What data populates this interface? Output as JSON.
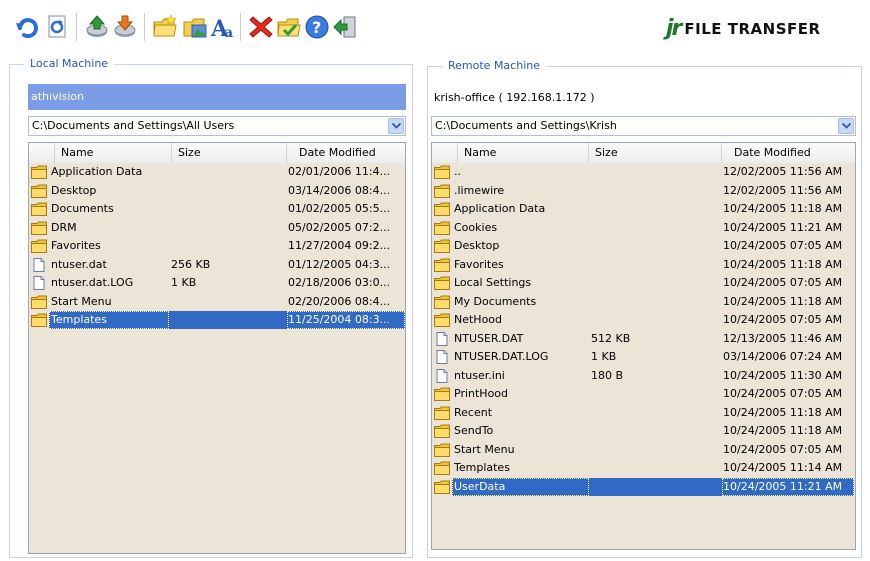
{
  "toolbar": {
    "icons": [
      "undo-icon",
      "refresh-icon",
      "upload-icon",
      "download-icon",
      "new-folder-icon",
      "folder-image-icon",
      "font-icon",
      "delete-icon",
      "properties-icon",
      "help-icon",
      "exit-icon"
    ]
  },
  "logo": {
    "mark": "jr",
    "text": "FILE TRANSFER"
  },
  "local": {
    "title": "Local Machine",
    "machine": "athivision",
    "path": "C:\\Documents and Settings\\All Users",
    "columns": [
      "Name",
      "Size",
      "Date Modified"
    ],
    "rows": [
      {
        "name": "Application Data",
        "size": "",
        "date": "02/01/2006 11:4...",
        "type": "folder"
      },
      {
        "name": "Desktop",
        "size": "",
        "date": "03/14/2006 08:4...",
        "type": "folder"
      },
      {
        "name": "Documents",
        "size": "",
        "date": "01/02/2005 05:5...",
        "type": "folder"
      },
      {
        "name": "DRM",
        "size": "",
        "date": "05/02/2005 07:2...",
        "type": "folder"
      },
      {
        "name": "Favorites",
        "size": "",
        "date": "11/27/2004 09:2...",
        "type": "folder"
      },
      {
        "name": "ntuser.dat",
        "size": "256 KB",
        "date": "01/12/2005 04:3...",
        "type": "file"
      },
      {
        "name": "ntuser.dat.LOG",
        "size": "1 KB",
        "date": "02/18/2006 03:0...",
        "type": "file"
      },
      {
        "name": "Start Menu",
        "size": "",
        "date": "02/20/2006 08:4...",
        "type": "folder"
      },
      {
        "name": "Templates",
        "size": "",
        "date": "11/25/2004 08:3...",
        "type": "folder",
        "selected": true
      }
    ]
  },
  "remote": {
    "title": "Remote Machine",
    "machine": "krish-office ( 192.168.1.172 )",
    "path": "C:\\Documents and Settings\\Krish",
    "columns": [
      "Name",
      "Size",
      "Date Modified"
    ],
    "rows": [
      {
        "name": "..",
        "size": "",
        "date": "12/02/2005 11:56 AM",
        "type": "folder"
      },
      {
        "name": ".limewire",
        "size": "",
        "date": "12/02/2005 11:56 AM",
        "type": "folder"
      },
      {
        "name": "Application Data",
        "size": "",
        "date": "10/24/2005 11:18 AM",
        "type": "folder"
      },
      {
        "name": "Cookies",
        "size": "",
        "date": "10/24/2005 11:21 AM",
        "type": "folder"
      },
      {
        "name": "Desktop",
        "size": "",
        "date": "10/24/2005 07:05 AM",
        "type": "folder"
      },
      {
        "name": "Favorites",
        "size": "",
        "date": "10/24/2005 11:18 AM",
        "type": "folder"
      },
      {
        "name": "Local Settings",
        "size": "",
        "date": "10/24/2005 07:05 AM",
        "type": "folder"
      },
      {
        "name": "My Documents",
        "size": "",
        "date": "10/24/2005 11:18 AM",
        "type": "folder"
      },
      {
        "name": "NetHood",
        "size": "",
        "date": "10/24/2005 07:05 AM",
        "type": "folder"
      },
      {
        "name": "NTUSER.DAT",
        "size": "512 KB",
        "date": "12/13/2005 11:46 AM",
        "type": "file"
      },
      {
        "name": "NTUSER.DAT.LOG",
        "size": "1 KB",
        "date": "03/14/2006 07:24 AM",
        "type": "file"
      },
      {
        "name": "ntuser.ini",
        "size": "180  B",
        "date": "10/24/2005 11:30 AM",
        "type": "file"
      },
      {
        "name": "PrintHood",
        "size": "",
        "date": "10/24/2005 07:05 AM",
        "type": "folder"
      },
      {
        "name": "Recent",
        "size": "",
        "date": "10/24/2005 11:18 AM",
        "type": "folder"
      },
      {
        "name": "SendTo",
        "size": "",
        "date": "10/24/2005 11:18 AM",
        "type": "folder"
      },
      {
        "name": "Start Menu",
        "size": "",
        "date": "10/24/2005 07:05 AM",
        "type": "folder"
      },
      {
        "name": "Templates",
        "size": "",
        "date": "10/24/2005 11:14 AM",
        "type": "folder"
      },
      {
        "name": "UserData",
        "size": "",
        "date": "10/24/2005 11:21 AM",
        "type": "folder",
        "selected": true
      }
    ]
  }
}
